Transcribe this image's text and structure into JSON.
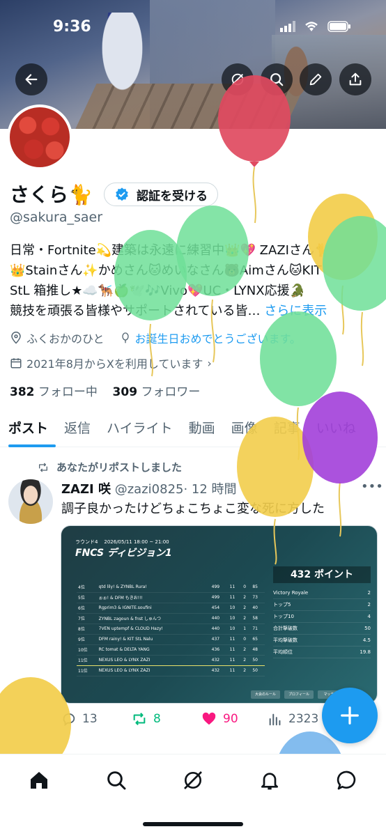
{
  "status_bar": {
    "time": "9:36"
  },
  "profile": {
    "name": "さくら🐈",
    "verify_label": "認証を受ける",
    "handle": "@sakura_saer",
    "bio_line1": "日常・Fortnite💫建築は永遠に練習中👑💖 ZAZIさん🐈",
    "bio_line2": "👑Stainさん✨かめさん🐱めいなさん🐻Aimさん🐱KIT",
    "bio_line3": "StL 箱推し★☁️🐕‍🦺🍏🕊️🎶Vivo💖UC・LYNX応援🐊",
    "bio_line4": "競技を頑張る皆様やサポートされている皆…",
    "bio_more": "さらに表示",
    "location": "ふくおかのひと",
    "birthday": "お誕生日おめでとうございます。",
    "joined": "2021年8月からXを利用しています",
    "following_count": "382",
    "following_label": "フォロー中",
    "followers_count": "309",
    "followers_label": "フォロワー"
  },
  "tabs": [
    "ポスト",
    "返信",
    "ハイライト",
    "動画",
    "画像",
    "記事",
    "いいね"
  ],
  "post": {
    "repost_note": "あなたがリポストしました",
    "author": "ZAZI 咲",
    "author_handle": "@zazi0825",
    "time": "· 12 時間",
    "text": "調子良かったけどちょこちょこ変な死に方した",
    "replies": "13",
    "reposts": "8",
    "likes": "90",
    "views": "2323",
    "colors": {
      "repost": "#00ba7c",
      "like": "#f91880"
    }
  },
  "media": {
    "round": "ラウンド4",
    "datetime": "2026/05/11 18:00 ~ 21:00",
    "logo": "FNCS ディビジョン1",
    "points": "432 ポイント",
    "stats": [
      {
        "label": "Victory Royale",
        "value": "2"
      },
      {
        "label": "トップ5",
        "value": "2"
      },
      {
        "label": "トップ10",
        "value": "4"
      },
      {
        "label": "合計撃破数",
        "value": "50"
      },
      {
        "label": "平均撃破数",
        "value": "4.5"
      },
      {
        "label": "平均順位",
        "value": "19.8"
      }
    ],
    "rows": [
      {
        "rank": "4位",
        "team": "qtd lily! & ZYNBL Rura!",
        "pts": "499",
        "m": "11",
        "w": "0",
        "k": "85"
      },
      {
        "rank": "5位",
        "team": "ぉぉ! & DFM もきお!!!",
        "pts": "499",
        "m": "11",
        "w": "2",
        "k": "73"
      },
      {
        "rank": "6位",
        "team": "Rgprim3 & IGNITE.soufini",
        "pts": "454",
        "m": "10",
        "w": "2",
        "k": "40"
      },
      {
        "rank": "7位",
        "team": "ZYNBL zagoun & fnst しゅんつ",
        "pts": "440",
        "m": "10",
        "w": "2",
        "k": "58"
      },
      {
        "rank": "8位",
        "team": "7VEN uptempf & CLOUD Hazy!",
        "pts": "440",
        "m": "10",
        "w": "1",
        "k": "71"
      },
      {
        "rank": "9位",
        "team": "DFM rainy! & KIT StL Nalu",
        "pts": "437",
        "m": "11",
        "w": "0",
        "k": "65"
      },
      {
        "rank": "10位",
        "team": "RC tomat & DELTA YANG",
        "pts": "436",
        "m": "11",
        "w": "2",
        "k": "48"
      },
      {
        "rank": "11位",
        "team": "NEXUS LEO & LYNX ZAZI",
        "pts": "432",
        "m": "11",
        "w": "2",
        "k": "50"
      },
      {
        "rank": "11位",
        "team": "NEXUS LEO & LYNX ZAZI",
        "pts": "432",
        "m": "11",
        "w": "2",
        "k": "50"
      }
    ],
    "footer_buttons": [
      "大会のルール",
      "プロフィール",
      "マッチ履歴"
    ]
  },
  "icons": {
    "back": "back-arrow-icon",
    "search": "search-icon",
    "edit": "pencil-icon",
    "share": "share-icon",
    "home": "home-icon",
    "explore": "search-icon",
    "grok": "grok-icon",
    "notifications": "bell-icon",
    "messages": "messages-icon",
    "compose": "plus-icon"
  },
  "accent_color": "#1d9bf0"
}
